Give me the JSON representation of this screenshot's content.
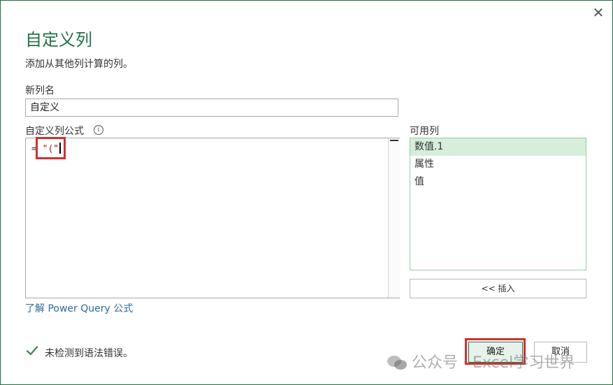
{
  "dialog": {
    "title": "自定义列",
    "subtitle": "添加从其他列计算的列。",
    "close_icon": "close-icon"
  },
  "new_column": {
    "label": "新列名",
    "value": "自定义"
  },
  "formula": {
    "label": "自定义列公式",
    "prefix": "= ",
    "text": "\"(\""
  },
  "available_columns": {
    "label": "可用列",
    "items": [
      {
        "label": "数值.1",
        "selected": true
      },
      {
        "label": "属性",
        "selected": false
      },
      {
        "label": "值",
        "selected": false
      }
    ],
    "insert_label": "<< 插入"
  },
  "learn_link": "了解 Power Query 公式",
  "status": {
    "icon": "checkmark-icon",
    "text": "未检测到语法错误。",
    "color": "#3a8f5a"
  },
  "buttons": {
    "ok": "确定",
    "cancel": "取消"
  },
  "watermark": {
    "text": "公众号 · Excel学习世界"
  },
  "colors": {
    "accent": "#217346",
    "highlight": "#d32f2f",
    "selection": "#d6eedb"
  }
}
